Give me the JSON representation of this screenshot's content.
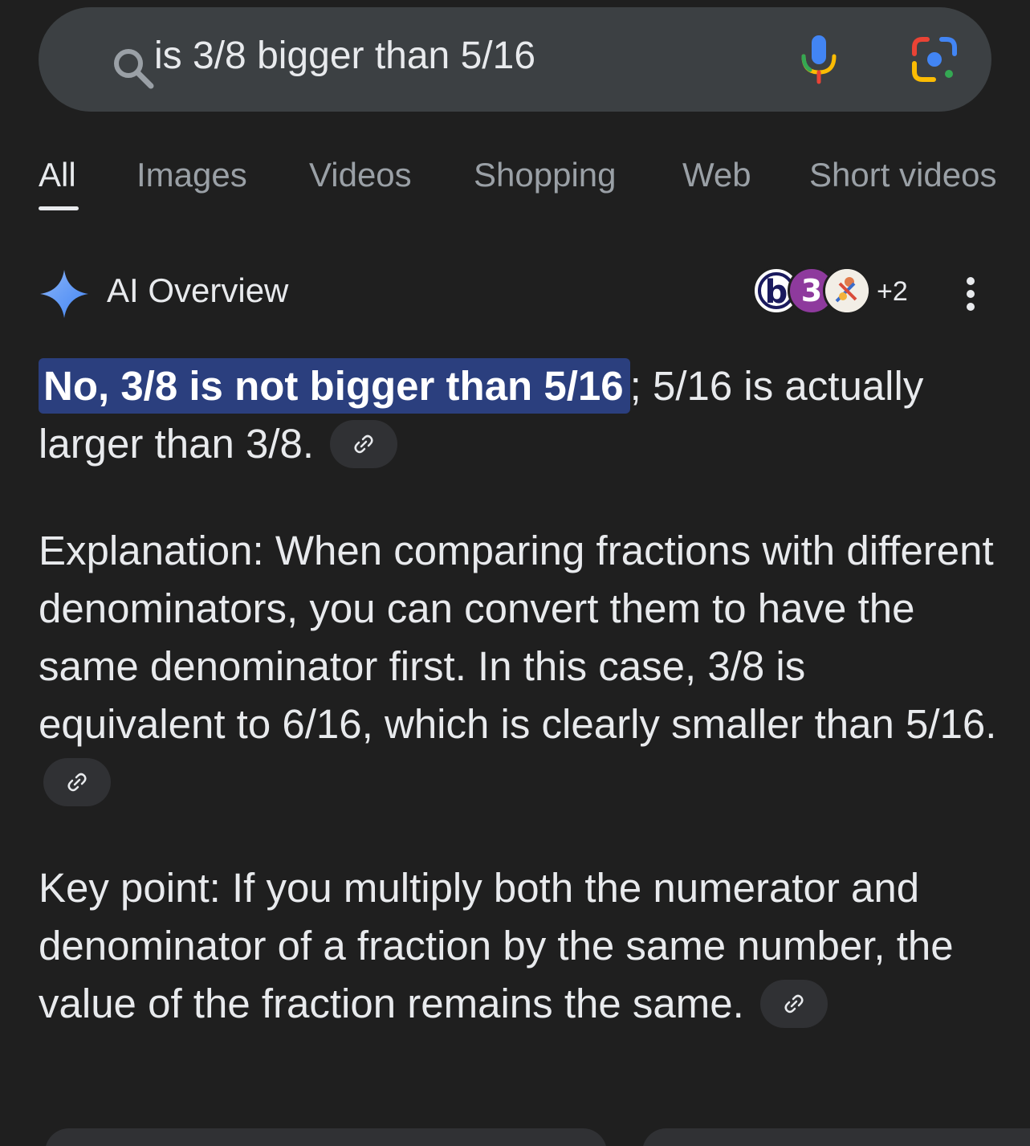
{
  "search": {
    "query": "is 3/8 bigger than 5/16"
  },
  "tabs": [
    {
      "label": "All",
      "active": true
    },
    {
      "label": "Images",
      "active": false
    },
    {
      "label": "Videos",
      "active": false
    },
    {
      "label": "Shopping",
      "active": false
    },
    {
      "label": "Web",
      "active": false
    },
    {
      "label": "Short videos",
      "active": false
    }
  ],
  "ai_overview": {
    "title": "AI Overview",
    "avatars": [
      {
        "letter": "b"
      },
      {
        "letter": "3"
      },
      {
        "icon": "illustration-avatar"
      }
    ],
    "more_sources": "+2",
    "paragraphs": {
      "p1_highlight": "No, 3/8 is not bigger than 5/16",
      "p1_rest": "; 5/16 is actually larger than 3/8.",
      "p2": "Explanation: When comparing fractions with different denominators, you can convert them to have the same denominator first. In this case, 3/8 is equivalent to 6/16, which is clearly smaller than 5/16.",
      "p3": "Key point: If you multiply both the numerator and denominator of a fraction by the same number, the value of the fraction remains the same."
    }
  },
  "colors": {
    "background": "#1f1f1f",
    "search_bar": "#3c4043",
    "highlight": "#2b3f7e",
    "chip": "#303134",
    "text": "#e8eaed",
    "muted_text": "#9aa0a6",
    "sparkle": "#8ab4f8"
  }
}
